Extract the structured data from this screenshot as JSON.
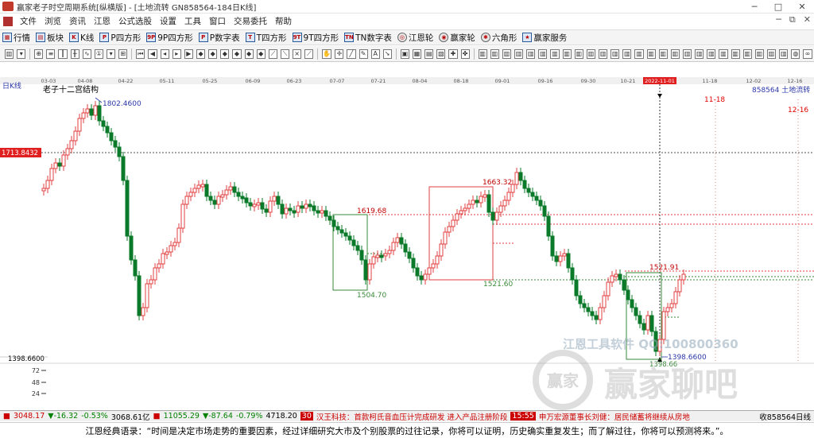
{
  "window": {
    "title": "赢家老子时空周期系统[纵横版] - [土地流转  GN858564-184日K线]",
    "minimize": "─",
    "maximize": "□",
    "close": "✕"
  },
  "menu": {
    "items": [
      "文件",
      "浏览",
      "资讯",
      "江恩",
      "公式选股",
      "设置",
      "工具",
      "窗口",
      "交易委托",
      "帮助"
    ],
    "right_icons": [
      "─",
      "⧉",
      "✕"
    ]
  },
  "toolbar1": {
    "items": [
      {
        "label": "行情",
        "icon": "grid-icon"
      },
      {
        "label": "板块",
        "icon": "blocks-icon"
      },
      {
        "label": "K线",
        "icon": "kline-icon"
      },
      {
        "label": "P四方形",
        "icon": "square-icon"
      },
      {
        "label": "9P四方形",
        "icon": "square9-icon"
      },
      {
        "label": "P数字表",
        "icon": "table-icon"
      },
      {
        "label": "T四方形",
        "icon": "t-square-icon"
      },
      {
        "label": "9T四方形",
        "icon": "t-square9-icon"
      },
      {
        "label": "TN数字表",
        "icon": "tn-table-icon"
      },
      {
        "label": "江恩轮",
        "icon": "wheel-icon"
      },
      {
        "label": "赢家轮",
        "icon": "wheel2-icon"
      },
      {
        "label": "六角形",
        "icon": "hexagon-icon"
      },
      {
        "label": "赢家服务",
        "icon": "service-icon"
      }
    ]
  },
  "chart_data": {
    "type": "candlestick",
    "symbol": "GN858564",
    "name": "土地流转",
    "period": "日K线",
    "date_ticks": [
      "03-03",
      "04-08",
      "04-22",
      "05-11",
      "05-25",
      "06-09",
      "06-23",
      "07-07",
      "07-21",
      "08-04",
      "08-18",
      "09-01",
      "09-16",
      "09-30",
      "10-21",
      "2022-11-01",
      "11-18",
      "12-02",
      "12-16"
    ],
    "cursor_date": "2022-11-01",
    "header_label": "858564 土地流转",
    "structure_label": "老子十二宫结构",
    "price_labels": {
      "high": "1802.4600",
      "p1663": "1663.32",
      "p1619": "1619.68",
      "p1521_60": "1521.60",
      "p1521_91": "1521.91",
      "p1504": "1504.70",
      "low": "1398.6600",
      "low_short": "1398.66",
      "left_price": "1713.8432",
      "left_low": "1398.6600"
    },
    "future_dates": [
      "11-18",
      "12-16"
    ],
    "volume_ticks": [
      "72",
      "48",
      "24"
    ],
    "ylim": [
      1380,
      1830
    ]
  },
  "ticker": {
    "sh_index": "3048.17",
    "sh_change": "▼-16.32",
    "sh_pct": "-0.53%",
    "sh_amount": "3068.61亿",
    "sz_index": "11055.29",
    "sz_change": "▼-87.64",
    "sz_pct": "-0.79%",
    "sz_amount": "4718.20",
    "news_badge1": "30",
    "news1": "汉王科技：首款柯氏音血压计完成研发 进入产品注册阶段",
    "news_badge2": "15:55",
    "news2": "申万宏源董事长刘健：居民储蓄将继续从房地",
    "status": "收858564日线"
  },
  "quote": {
    "text": "江恩经典语录：“时间是决定市场走势的重要因素，经过详细研究大市及个别股票的过往记录，你将可以证明，历史确实重复发生；而了解过往，你将可以预测将来。”。"
  },
  "watermark": {
    "line1": "江恩工具软件 QQ:100800360",
    "line2": "赢家聊吧",
    "stamp": "赢家"
  }
}
